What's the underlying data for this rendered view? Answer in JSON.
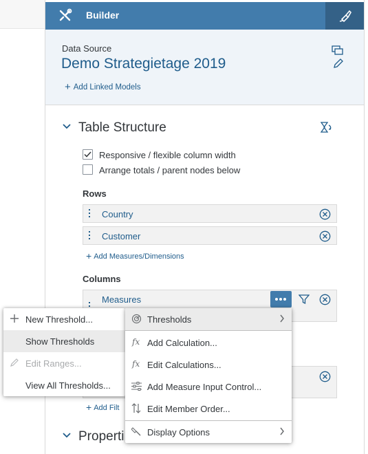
{
  "header": {
    "title": "Builder",
    "builder_icon": "tools-icon",
    "right_icon": "paint-brush-icon"
  },
  "data_source": {
    "label": "Data Source",
    "name": "Demo Strategietage 2019",
    "add_linked_models": "Add Linked Models",
    "icons": [
      "copy-icon",
      "edit-icon"
    ]
  },
  "table_structure": {
    "title": "Table Structure",
    "options": [
      {
        "label": "Responsive / flexible column width",
        "checked": true
      },
      {
        "label": "Arrange totals / parent nodes below",
        "checked": false
      }
    ],
    "rows_label": "Rows",
    "rows": [
      "Country",
      "Customer"
    ],
    "add_measures": "Add Measures/Dimensions",
    "columns_label": "Columns",
    "columns": [
      "Measures"
    ],
    "add_filter_partial": "Add Filt"
  },
  "properties": {
    "title": "Properti"
  },
  "threshold_menu": {
    "items": [
      {
        "label": "New Threshold...",
        "icon": "plus-icon",
        "enabled": true
      },
      {
        "label": "Show Thresholds",
        "icon": "",
        "enabled": true,
        "highlighted": true
      },
      {
        "label": "Edit Ranges...",
        "icon": "pencil-icon",
        "enabled": false
      },
      {
        "label": "View All Thresholds...",
        "icon": "",
        "enabled": true
      }
    ]
  },
  "context_menu": {
    "items": [
      {
        "label": "Thresholds",
        "icon": "thresholds-icon",
        "submenu": true,
        "highlighted": true
      },
      {
        "label": "Add Calculation...",
        "icon": "fx-icon"
      },
      {
        "label": "Edit Calculations...",
        "icon": "fx-icon"
      },
      {
        "label": "Add Measure Input Control...",
        "icon": "sliders-icon"
      },
      {
        "label": "Edit Member Order...",
        "icon": "sort-icon"
      },
      {
        "label": "Display Options",
        "icon": "display-options-icon",
        "submenu": true
      }
    ]
  },
  "colors": {
    "header_bg": "#427cac",
    "header_dark": "#346187",
    "link": "#1f5c8b",
    "ds_bg": "#eff4f9"
  }
}
